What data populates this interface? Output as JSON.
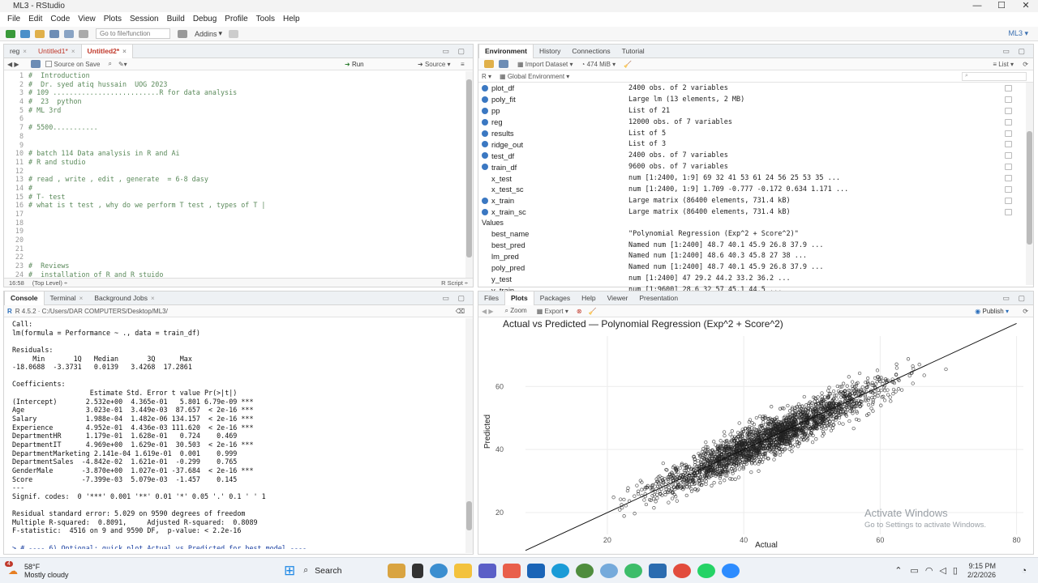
{
  "window": {
    "title": "ML3 - RStudio",
    "project": "ML3"
  },
  "menu": [
    "File",
    "Edit",
    "Code",
    "View",
    "Plots",
    "Session",
    "Build",
    "Debug",
    "Profile",
    "Tools",
    "Help"
  ],
  "toolbar": {
    "goto_placeholder": "Go to file/function",
    "addins": "Addins"
  },
  "editor": {
    "tabs": [
      {
        "label": "reg",
        "active": false
      },
      {
        "label": "Untitled1*",
        "active": false
      },
      {
        "label": "Untitled2*",
        "active": true
      }
    ],
    "source_on_save": "Source on Save",
    "run": "Run",
    "source": "Source",
    "lines": [
      "#  Introduction",
      "#  Dr. syed atiq hussain  UOG 2023",
      "# 109 ..........................R for data analysis",
      "#  23  python",
      "# ML 3rd",
      "",
      "# 5500...........",
      "",
      "",
      "# batch 114 Data analysis in R and Ai",
      "# R and studio",
      "",
      "# read , write , edit , generate  = 6-8 dasy",
      "#",
      "# T- test",
      "# what is t test , why do we perform T test , types of T |",
      "",
      "",
      "",
      "",
      "",
      "",
      "#  Reviews",
      "#  installation of R and R stuido"
    ],
    "status_pos": "16:58",
    "status_level": "(Top Level) ÷",
    "status_type": "R Script ÷"
  },
  "console": {
    "tabs": [
      "Console",
      "Terminal",
      "Background Jobs"
    ],
    "path": "R 4.5.2 · C:/Users/DAR COMPUTERS/Desktop/ML3/",
    "lines": [
      "Call:",
      "lm(formula = Performance ~ ., data = train_df)",
      "",
      "Residuals:",
      "     Min       1Q   Median       3Q      Max ",
      "-18.0688  -3.3731   0.0139   3.4268  17.2861 ",
      "",
      "Coefficients:",
      "                   Estimate Std. Error t value Pr(>|t|)    ",
      "(Intercept)       2.532e+00  4.365e-01   5.801 6.79e-09 ***",
      "Age               3.023e-01  3.449e-03  87.657  < 2e-16 ***",
      "Salary            1.988e-04  1.482e-06 134.157  < 2e-16 ***",
      "Experience        4.952e-01  4.436e-03 111.620  < 2e-16 ***",
      "DepartmentHR      1.179e-01  1.628e-01   0.724    0.469    ",
      "DepartmentIT      4.969e+00  1.629e-01  30.503  < 2e-16 ***",
      "DepartmentMarketing 2.141e-04 1.619e-01  0.001    0.999    ",
      "DepartmentSales  -4.842e-02  1.621e-01  -0.299    0.765    ",
      "GenderMale       -3.870e+00  1.027e-01 -37.684  < 2e-16 ***",
      "Score            -7.399e-03  5.079e-03  -1.457    0.145    ",
      "---",
      "Signif. codes:  0 '***' 0.001 '**' 0.01 '*' 0.05 '.' 0.1 ' ' 1",
      "",
      "Residual standard error: 5.029 on 9590 degrees of freedom",
      "Multiple R-squared:  0.8091,     Adjusted R-squared:  0.8089 ",
      "F-statistic:  4516 on 9 and 9590 DF,  p-value: < 2.2e-16",
      "",
      "> # ---- 6) Optional: quick plot Actual vs Predicted for best model ----"
    ]
  },
  "env": {
    "tabs": [
      "Environment",
      "History",
      "Connections",
      "Tutorial"
    ],
    "import_dataset": "Import Dataset",
    "memory": "474 MiB",
    "list_view": "List",
    "lang": "R",
    "scope": "Global Environment",
    "rows": [
      {
        "name": "plot_df",
        "value": "2400 obs. of 2 variables",
        "expand": true
      },
      {
        "name": "poly_fit",
        "value": "Large lm (13 elements, 2 MB)",
        "expand": true
      },
      {
        "name": "pp",
        "value": "List of  21",
        "expand": true
      },
      {
        "name": "reg",
        "value": "12000 obs. of 7 variables",
        "expand": true
      },
      {
        "name": "results",
        "value": "List of  5",
        "expand": true
      },
      {
        "name": "ridge_out",
        "value": "List of  3",
        "expand": true
      },
      {
        "name": "test_df",
        "value": "2400 obs. of 7 variables",
        "expand": true
      },
      {
        "name": "train_df",
        "value": "9600 obs. of 7 variables",
        "expand": true
      },
      {
        "name": "x_test",
        "value": "num [1:2400, 1:9] 69 32 41 53 61 24 56 25 53 35 ...",
        "expand": false
      },
      {
        "name": "x_test_sc",
        "value": "num [1:2400, 1:9] 1.709 -0.777 -0.172 0.634 1.171 ...",
        "expand": false
      },
      {
        "name": "x_train",
        "value": "Large matrix (86400 elements, 731.4 kB)",
        "expand": true
      },
      {
        "name": "x_train_sc",
        "value": "Large matrix (86400 elements, 731.4 kB)",
        "expand": true
      }
    ],
    "values_header": "Values",
    "values": [
      {
        "name": "best_name",
        "value": "\"Polynomial Regression (Exp^2 + Score^2)\""
      },
      {
        "name": "best_pred",
        "value": "Named num [1:2400] 48.7 40.1 45.9 26.8 37.9 ..."
      },
      {
        "name": "lm_pred",
        "value": "Named num [1:2400] 48.6 40.3 45.8 27 38 ..."
      },
      {
        "name": "poly_pred",
        "value": "Named num [1:2400] 48.7 40.1 45.9 26.8 37.9 ..."
      },
      {
        "name": "y_test",
        "value": "num [1:2400] 47 29.2 44.2 33.2 36.2 ..."
      },
      {
        "name": "y_train",
        "value": "num [1:9600] 28.6 32 57 45.1 44.5 ..."
      }
    ]
  },
  "files": {
    "tabs": [
      "Files",
      "Plots",
      "Packages",
      "Help",
      "Viewer",
      "Presentation"
    ],
    "zoom": "Zoom",
    "export": "Export",
    "publish": "Publish"
  },
  "chart_data": {
    "type": "scatter",
    "title": "Actual vs Predicted — Polynomial Regression (Exp^2 + Score^2)",
    "xlabel": "Actual",
    "ylabel": "Predicted",
    "xlim": [
      8,
      81
    ],
    "ylim": [
      10,
      76
    ],
    "xticks": [
      20,
      40,
      60,
      80
    ],
    "yticks": [
      20,
      40,
      60
    ],
    "n_points": 2400,
    "reference_line": {
      "from": [
        8,
        8
      ],
      "to": [
        80,
        80
      ]
    },
    "point_color": "#222222"
  },
  "watermark": {
    "line1": "Activate Windows",
    "line2": "Go to Settings to activate Windows."
  },
  "taskbar": {
    "weather_temp": "58°F",
    "weather_desc": "Mostly cloudy",
    "search": "Search",
    "time": "9:15 PM",
    "date": "2/2/2026",
    "badge": "4"
  }
}
